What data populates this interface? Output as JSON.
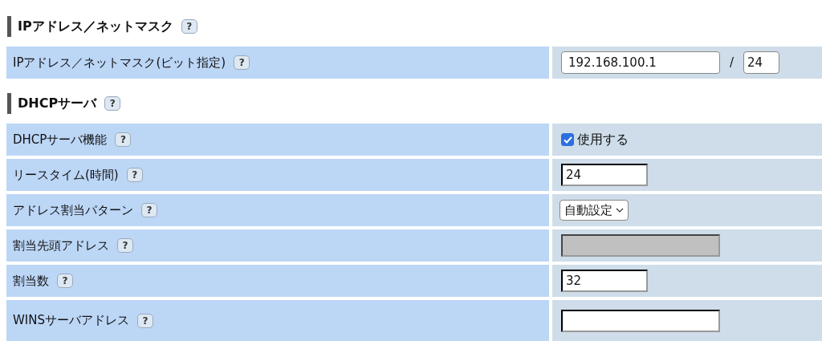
{
  "sections": [
    {
      "title": "IPアドレス／ネットマスク",
      "help": "?",
      "rows": [
        {
          "label": "IPアドレス／ネットマスク(ビット指定)",
          "help": "?",
          "kind": "ip_mask",
          "value": "192.168.100.1",
          "separator": "/",
          "mask": "24"
        }
      ]
    },
    {
      "title": "DHCPサーバ",
      "help": "?",
      "rows": [
        {
          "label": "DHCPサーバ機能",
          "help": "?",
          "kind": "checkbox",
          "checked": true,
          "text": "使用する"
        },
        {
          "label": "リースタイム(時間)",
          "help": "?",
          "kind": "short_text",
          "value": "24"
        },
        {
          "label": "アドレス割当パターン",
          "help": "?",
          "kind": "select",
          "value": "自動設定"
        },
        {
          "label": "割当先頭アドレス",
          "help": "?",
          "kind": "long_text",
          "disabled": true
        },
        {
          "label": "割当数",
          "help": "?",
          "kind": "short_text",
          "value": "32"
        },
        {
          "label": "WINSサーバアドレス",
          "help": "?",
          "kind": "long_text",
          "disabled": false
        }
      ]
    }
  ]
}
